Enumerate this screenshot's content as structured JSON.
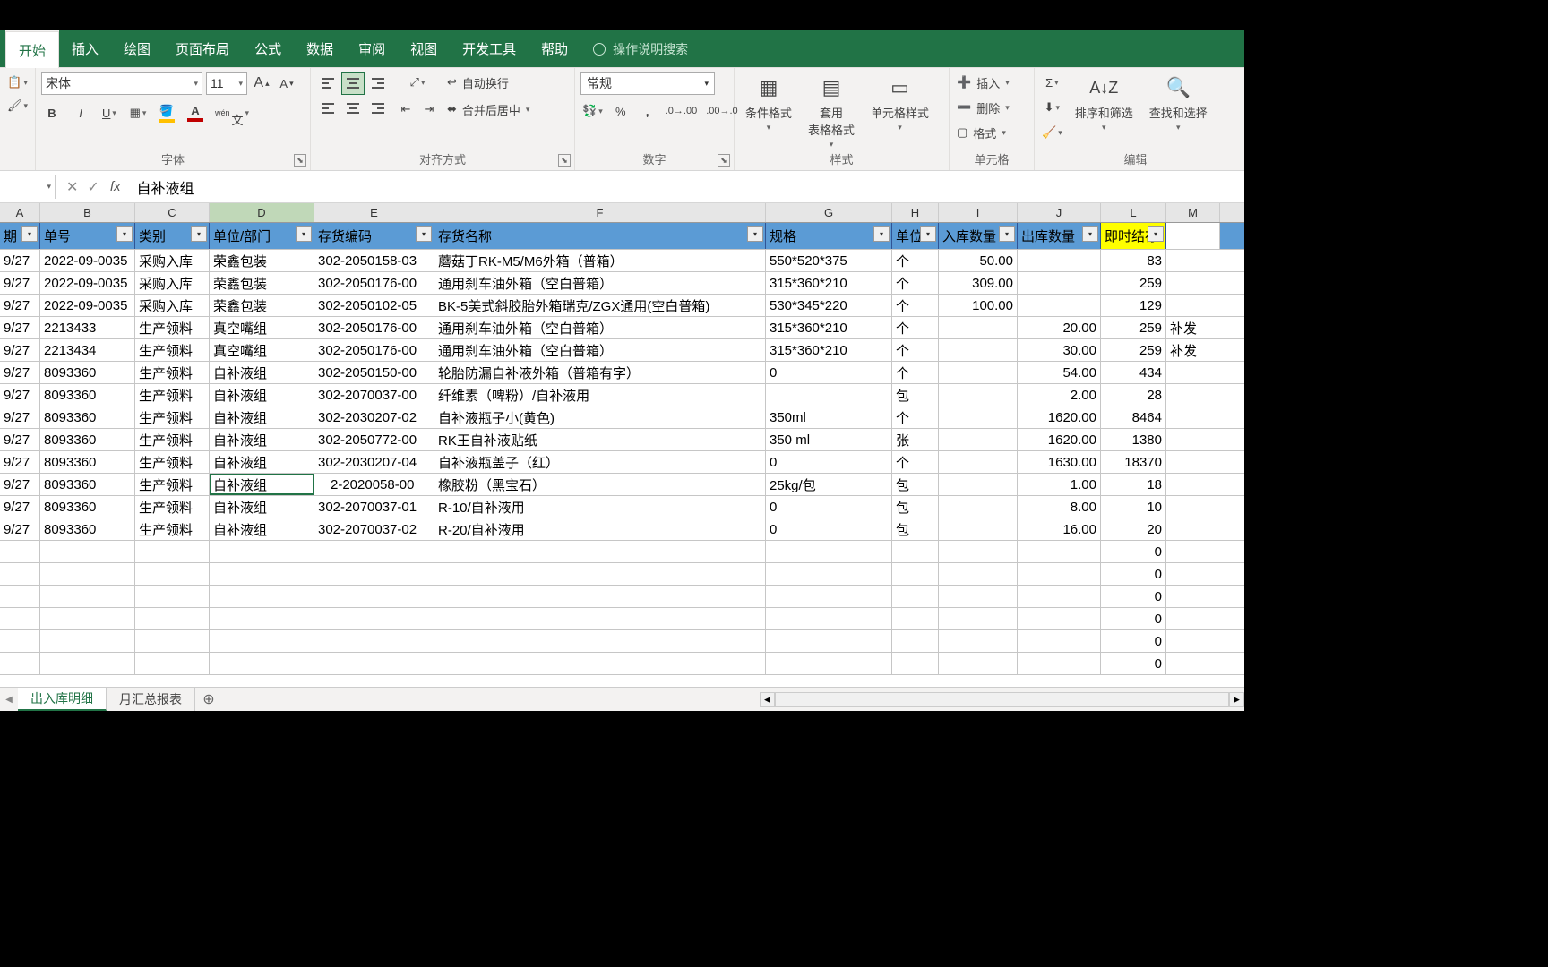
{
  "tabs": [
    "开始",
    "插入",
    "绘图",
    "页面布局",
    "公式",
    "数据",
    "审阅",
    "视图",
    "开发工具",
    "帮助"
  ],
  "tell_me": "操作说明搜索",
  "font": {
    "name": "宋体",
    "size": "11"
  },
  "groups": {
    "font": "字体",
    "align": "对齐方式",
    "number": "数字",
    "styles": "样式",
    "cells": "单元格",
    "editing": "编辑"
  },
  "ribbon": {
    "wrap": "自动换行",
    "merge": "合并后居中",
    "num_format": "常规",
    "cond_fmt": "条件格式",
    "table_fmt": "套用\n表格格式",
    "cell_style": "单元格样式",
    "insert": "插入",
    "delete": "删除",
    "format": "格式",
    "sort": "排序和筛选",
    "find": "查找和选择"
  },
  "formula": {
    "value": "自补液组"
  },
  "active_cell_dd": "▼",
  "cols": [
    "A",
    "B",
    "C",
    "D",
    "E",
    "F",
    "G",
    "H",
    "I",
    "J",
    "L",
    "M"
  ],
  "headers": [
    "期",
    "单号",
    "类别",
    "单位/部门",
    "存货编码",
    "存货名称",
    "规格",
    "单位",
    "入库数量",
    "出库数量",
    "即时结存"
  ],
  "rows": [
    {
      "a": "9/27",
      "b": "2022-09-0035",
      "c": "采购入库",
      "d": "荣鑫包装",
      "e": "302-2050158-03",
      "f": "蘑菇丁RK-M5/M6外箱（普箱）",
      "g": "550*520*375",
      "h": "个",
      "i": "50.00",
      "j": "",
      "l": "83",
      "m": ""
    },
    {
      "a": "9/27",
      "b": "2022-09-0035",
      "c": "采购入库",
      "d": "荣鑫包装",
      "e": "302-2050176-00",
      "f": "通用刹车油外箱（空白普箱）",
      "g": "315*360*210",
      "h": "个",
      "i": "309.00",
      "j": "",
      "l": "259",
      "m": ""
    },
    {
      "a": "9/27",
      "b": "2022-09-0035",
      "c": "采购入库",
      "d": "荣鑫包装",
      "e": "302-2050102-05",
      "f": "BK-5美式斜胶胎外箱瑞克/ZGX通用(空白普箱)",
      "g": "530*345*220",
      "h": "个",
      "i": "100.00",
      "j": "",
      "l": "129",
      "m": ""
    },
    {
      "a": "9/27",
      "b": "2213433",
      "c": "生产领料",
      "d": "真空嘴组",
      "e": "302-2050176-00",
      "f": "通用刹车油外箱（空白普箱）",
      "g": "315*360*210",
      "h": "个",
      "i": "",
      "j": "20.00",
      "l": "259",
      "m": "补发"
    },
    {
      "a": "9/27",
      "b": "2213434",
      "c": "生产领料",
      "d": "真空嘴组",
      "e": "302-2050176-00",
      "f": "通用刹车油外箱（空白普箱）",
      "g": "315*360*210",
      "h": "个",
      "i": "",
      "j": "30.00",
      "l": "259",
      "m": "补发"
    },
    {
      "a": "9/27",
      "b": "8093360",
      "c": "生产领料",
      "d": "自补液组",
      "e": "302-2050150-00",
      "f": "轮胎防漏自补液外箱（普箱有字）",
      "g": "0",
      "h": "个",
      "i": "",
      "j": "54.00",
      "l": "434",
      "m": ""
    },
    {
      "a": "9/27",
      "b": "8093360",
      "c": "生产领料",
      "d": "自补液组",
      "e": "302-2070037-00",
      "f": "纤维素（啤粉）/自补液用",
      "g": "",
      "h": "包",
      "i": "",
      "j": "2.00",
      "l": "28",
      "m": ""
    },
    {
      "a": "9/27",
      "b": "8093360",
      "c": "生产领料",
      "d": "自补液组",
      "e": "302-2030207-02",
      "f": "自补液瓶子小(黄色)",
      "g": "350ml",
      "h": "个",
      "i": "",
      "j": "1620.00",
      "l": "8464",
      "m": ""
    },
    {
      "a": "9/27",
      "b": "8093360",
      "c": "生产领料",
      "d": "自补液组",
      "e": "302-2050772-00",
      "f": "RK王自补液贴纸",
      "g": "350 ml",
      "h": "张",
      "i": "",
      "j": "1620.00",
      "l": "1380",
      "m": ""
    },
    {
      "a": "9/27",
      "b": "8093360",
      "c": "生产领料",
      "d": "自补液组",
      "e": "302-2030207-04",
      "f": "自补液瓶盖子（红）",
      "g": "0",
      "h": "个",
      "i": "",
      "j": "1630.00",
      "l": "18370",
      "m": ""
    },
    {
      "a": "9/27",
      "b": "8093360",
      "c": "生产领料",
      "d": "自补液组",
      "e": "2-2020058-00",
      "f": "橡胶粉（黑宝石）",
      "g": "25kg/包",
      "h": "包",
      "i": "",
      "j": "1.00",
      "l": "18",
      "m": "",
      "active": true
    },
    {
      "a": "9/27",
      "b": "8093360",
      "c": "生产领料",
      "d": "自补液组",
      "e": "302-2070037-01",
      "f": "R-10/自补液用",
      "g": "0",
      "h": "包",
      "i": "",
      "j": "8.00",
      "l": "10",
      "m": ""
    },
    {
      "a": "9/27",
      "b": "8093360",
      "c": "生产领料",
      "d": "自补液组",
      "e": "302-2070037-02",
      "f": "R-20/自补液用",
      "g": "0",
      "h": "包",
      "i": "",
      "j": "16.00",
      "l": "20",
      "m": ""
    },
    {
      "a": "",
      "b": "",
      "c": "",
      "d": "",
      "e": "",
      "f": "",
      "g": "",
      "h": "",
      "i": "",
      "j": "",
      "l": "0",
      "m": ""
    },
    {
      "a": "",
      "b": "",
      "c": "",
      "d": "",
      "e": "",
      "f": "",
      "g": "",
      "h": "",
      "i": "",
      "j": "",
      "l": "0",
      "m": ""
    },
    {
      "a": "",
      "b": "",
      "c": "",
      "d": "",
      "e": "",
      "f": "",
      "g": "",
      "h": "",
      "i": "",
      "j": "",
      "l": "0",
      "m": ""
    },
    {
      "a": "",
      "b": "",
      "c": "",
      "d": "",
      "e": "",
      "f": "",
      "g": "",
      "h": "",
      "i": "",
      "j": "",
      "l": "0",
      "m": ""
    },
    {
      "a": "",
      "b": "",
      "c": "",
      "d": "",
      "e": "",
      "f": "",
      "g": "",
      "h": "",
      "i": "",
      "j": "",
      "l": "0",
      "m": ""
    },
    {
      "a": "",
      "b": "",
      "c": "",
      "d": "",
      "e": "",
      "f": "",
      "g": "",
      "h": "",
      "i": "",
      "j": "",
      "l": "0",
      "m": ""
    }
  ],
  "sheets": [
    "出入库明细",
    "月汇总报表"
  ]
}
